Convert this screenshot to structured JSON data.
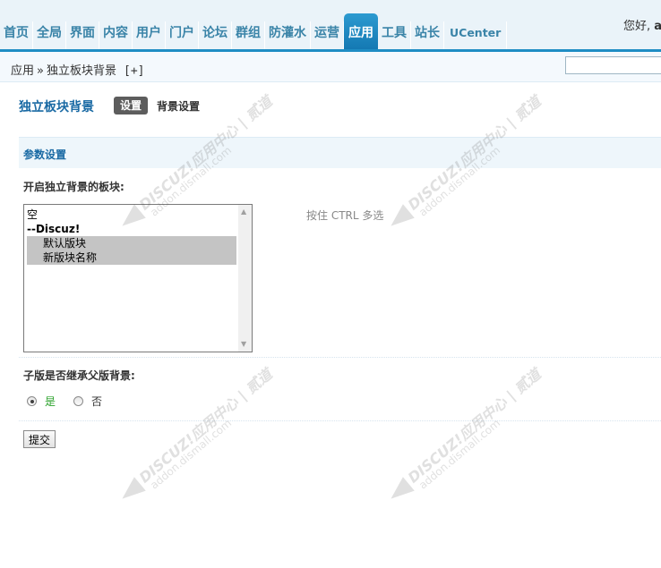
{
  "nav": {
    "items": [
      {
        "label": "首页"
      },
      {
        "label": "全局"
      },
      {
        "label": "界面"
      },
      {
        "label": "内容"
      },
      {
        "label": "用户"
      },
      {
        "label": "门户"
      },
      {
        "label": "论坛"
      },
      {
        "label": "群组"
      },
      {
        "label": "防灌水"
      },
      {
        "label": "运营"
      },
      {
        "label": "应用",
        "active": true
      },
      {
        "label": "工具"
      },
      {
        "label": "站长"
      },
      {
        "label": "UCenter"
      }
    ],
    "greeting": "您好,",
    "username": "ad"
  },
  "breadcrumb": {
    "root": "应用",
    "separator": "»",
    "current": "独立板块背景",
    "add": "[+]"
  },
  "page": {
    "title": "独立板块背景",
    "tabs": {
      "active": "设置",
      "other": "背景设置"
    }
  },
  "section": {
    "title": "参数设置"
  },
  "forums_field": {
    "label": "开启独立背景的板块:",
    "options": [
      {
        "label": "空",
        "type": "option"
      },
      {
        "label": "--Discuz!",
        "type": "group"
      },
      {
        "label": "默认版块",
        "type": "option",
        "selected": true
      },
      {
        "label": "新版块名称",
        "type": "option",
        "selected": true
      }
    ],
    "hint": "按住 CTRL 多选"
  },
  "inherit_field": {
    "label": "子版是否继承父版背景:",
    "yes": "是",
    "no": "否",
    "selected": "yes"
  },
  "submit_label": "提交",
  "watermark": {
    "line1": "DISCUZ!应用中心 | 贰道",
    "line2": "addon.dismall.com"
  },
  "colors": {
    "accent": "#1f8dc4",
    "title": "#1a6aa4",
    "nav_text": "#3a84a8"
  }
}
